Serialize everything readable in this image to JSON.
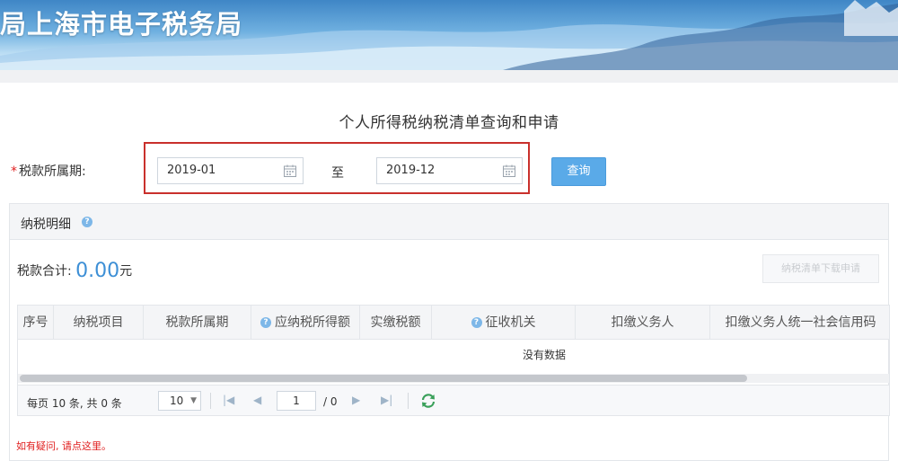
{
  "banner": {
    "title": "局上海市电子税务局"
  },
  "page": {
    "title": "个人所得税纳税清单查询和申请"
  },
  "query": {
    "period_label": "税款所属期:",
    "required_mark": "*",
    "start_date": "2019-01",
    "to_label": "至",
    "end_date": "2019-12",
    "query_button": "查询"
  },
  "detail": {
    "title": "纳税明细",
    "total_label": "税款合计:",
    "total_amount": "0.00",
    "total_unit": "元",
    "download_button": "纳税清单下载申请"
  },
  "table": {
    "columns": [
      "序号",
      "纳税项目",
      "税款所属期",
      "应纳税所得额",
      "实缴税额",
      "征收机关",
      "扣缴义务人",
      "扣缴义务人统一社会信用码"
    ],
    "empty_text": "没有数据"
  },
  "pager": {
    "summary": "每页 10 条, 共 0 条",
    "page_size": "10",
    "current_page": "1",
    "total_pages": "/ 0"
  },
  "footer": {
    "help_link": "如有疑问, 请点这里。"
  },
  "colors": {
    "accent": "#5aaae8",
    "highlight_border": "#c9302c",
    "link": "#e02020"
  }
}
